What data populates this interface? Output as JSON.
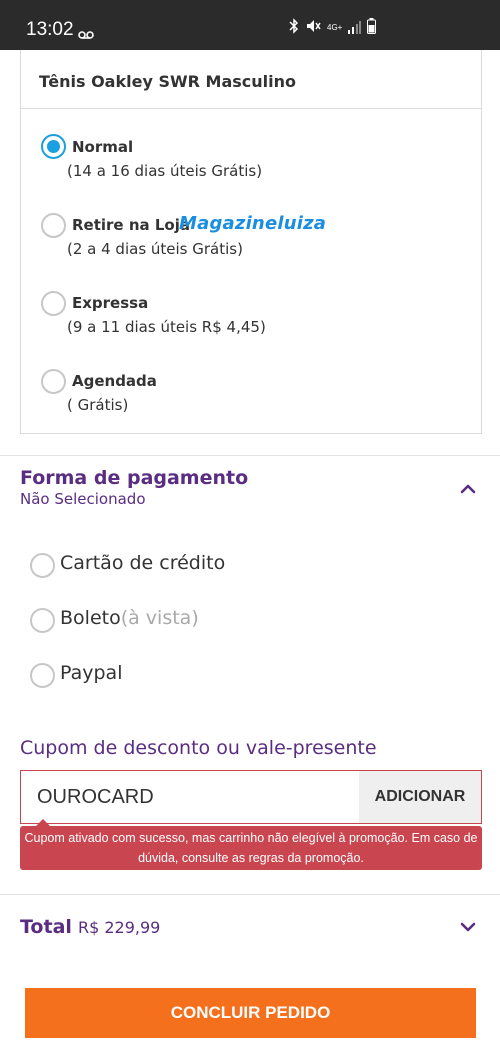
{
  "status_bar": {
    "time": "13:02",
    "network": "4G+"
  },
  "shipping": {
    "product_name": "Tênis Oakley SWR Masculino",
    "options": [
      {
        "title": "Normal",
        "detail": "(14 a 16 dias úteis Grátis)",
        "selected": true
      },
      {
        "title": "Retire na Loja",
        "logo": "Magazineluiza",
        "detail": "(2 a 4 dias úteis Grátis)",
        "selected": false
      },
      {
        "title": "Expressa",
        "detail": "(9 a 11 dias úteis R$ 4,45)",
        "selected": false
      },
      {
        "title": "Agendada",
        "detail": "( Grátis)",
        "selected": false
      }
    ]
  },
  "payment": {
    "title": "Forma de pagamento",
    "status": "Não Selecionado",
    "methods": [
      {
        "label": "Cartão de crédito",
        "note": ""
      },
      {
        "label": "Boleto",
        "note": "(à vista)"
      },
      {
        "label": "Paypal",
        "note": ""
      }
    ]
  },
  "coupon": {
    "label": "Cupom de desconto ou vale-presente",
    "value": "OUROCARD",
    "button": "ADICIONAR",
    "message": "Cupom ativado com sucesso, mas carrinho não elegível à promoção. Em caso de dúvida, consulte as regras da promoção."
  },
  "total": {
    "label": "Total",
    "value": "R$ 229,99"
  },
  "cta": {
    "label": "CONCLUIR PEDIDO"
  },
  "colors": {
    "accent_purple": "#5a2d82",
    "radio_blue": "#1aa0e0",
    "cta_orange": "#f4701d",
    "error_red": "#c94650"
  },
  "icons": [
    "voicemail-icon",
    "bluetooth-icon",
    "mute-icon",
    "signal-icon",
    "battery-icon",
    "chevron-up-icon",
    "chevron-down-icon"
  ]
}
